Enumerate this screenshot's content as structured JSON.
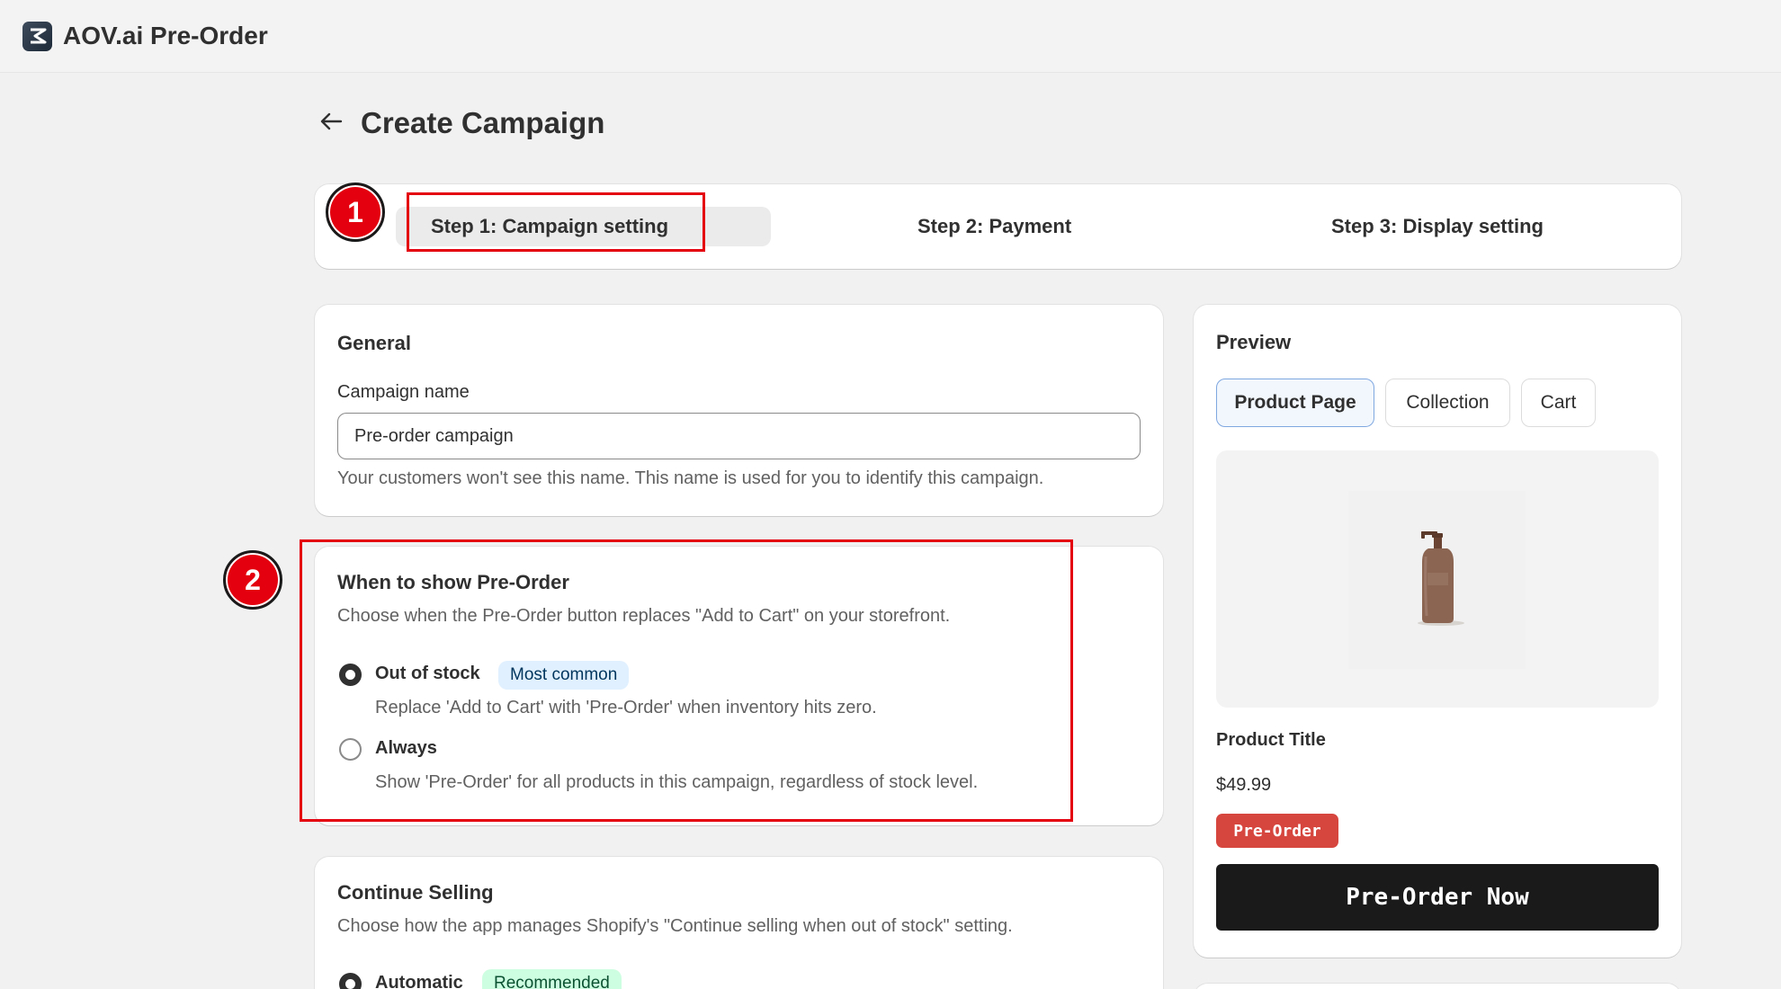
{
  "app": {
    "title": "AOV.ai Pre-Order",
    "logo_icon": "aov-logo-icon"
  },
  "page": {
    "title": "Create Campaign"
  },
  "steps": [
    {
      "label": "Step 1: Campaign setting",
      "active": true
    },
    {
      "label": "Step 2: Payment",
      "active": false
    },
    {
      "label": "Step 3: Display setting",
      "active": false
    }
  ],
  "annotations": [
    "1",
    "2"
  ],
  "general": {
    "title": "General",
    "campaign_name_label": "Campaign name",
    "campaign_name_value": "Pre-order campaign",
    "help_text": "Your customers won't see this name. This name is used for you to identify this campaign."
  },
  "when_to_show": {
    "title": "When to show Pre-Order",
    "description": "Choose when the Pre-Order button replaces \"Add to Cart\" on your storefront.",
    "options": [
      {
        "label": "Out of stock",
        "badge": "Most common",
        "description": "Replace 'Add to Cart' with 'Pre-Order' when inventory hits zero.",
        "selected": true
      },
      {
        "label": "Always",
        "description": "Show 'Pre-Order' for all products in this campaign, regardless of stock level.",
        "selected": false
      }
    ]
  },
  "continue_selling": {
    "title": "Continue Selling",
    "description": "Choose how the app manages Shopify's \"Continue selling when out of stock\" setting.",
    "options": [
      {
        "label": "Automatic",
        "badge": "Recommended",
        "selected": true
      }
    ]
  },
  "preview": {
    "title": "Preview",
    "tabs": [
      {
        "label": "Product Page",
        "selected": true
      },
      {
        "label": "Collection",
        "selected": false
      },
      {
        "label": "Cart",
        "selected": false
      }
    ],
    "product_title": "Product Title",
    "price": "$49.99",
    "badge": "Pre-Order",
    "button": "Pre-Order Now"
  },
  "colors": {
    "annotation_red": "#e4000f",
    "preorder_badge": "#d6463f",
    "preorder_button": "#1a1a1a",
    "badge_blue_bg": "#e0f0ff",
    "badge_green_bg": "#cdfee1"
  }
}
